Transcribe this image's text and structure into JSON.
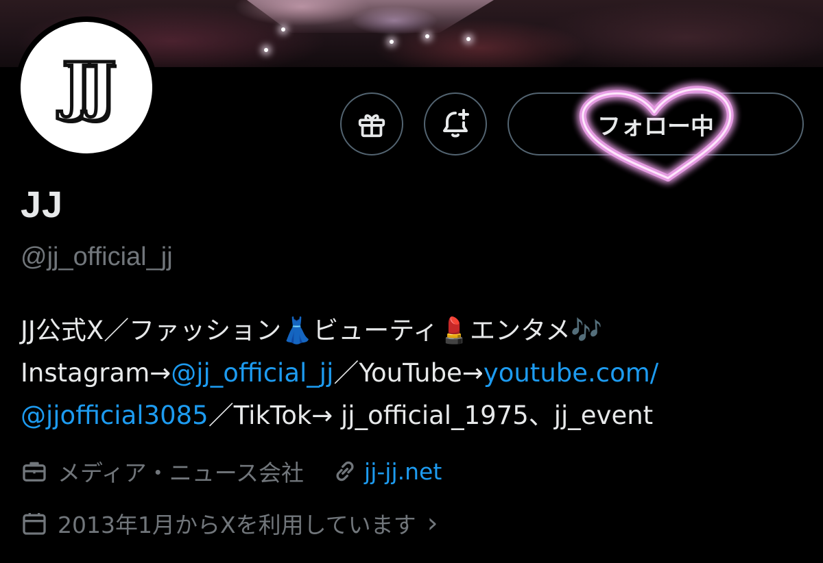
{
  "profile": {
    "display_name": "JJ",
    "handle": "@jj_official_jj",
    "avatar_text": "JJ",
    "follow_label": "フォロー中"
  },
  "bio": {
    "line1": {
      "part1": "JJ公式X／ファッション",
      "emoji1": "👗",
      "part2": "ビューティ",
      "emoji2": "💄",
      "part3": "エンタメ",
      "emoji3": "🎶"
    },
    "line2": {
      "prefix": "Instagram→",
      "instagram_link": "@jj_official_jj",
      "middle": "／YouTube→",
      "youtube_link": "youtube.com/"
    },
    "line3": {
      "youtube_link_cont": "@jjofficial3085",
      "suffix": "／TikTok→ jj_official_1975、jj_event"
    }
  },
  "meta": {
    "category": "メディア・ニュース会社",
    "website": "jj-jj.net",
    "joined": "2013年1月からXを利用しています",
    "chevron": "›"
  },
  "icons": {
    "gift": "gift-icon",
    "bell": "bell-plus-icon",
    "briefcase": "briefcase-icon",
    "link": "link-icon",
    "calendar": "calendar-icon",
    "heart_overlay": "heart-doodle-icon"
  },
  "colors": {
    "background": "#000000",
    "text_primary": "#e7e9ea",
    "text_secondary": "#71767b",
    "link": "#1d9bf0",
    "button_border": "#536471",
    "heart_glow": "#f3a6f0"
  }
}
